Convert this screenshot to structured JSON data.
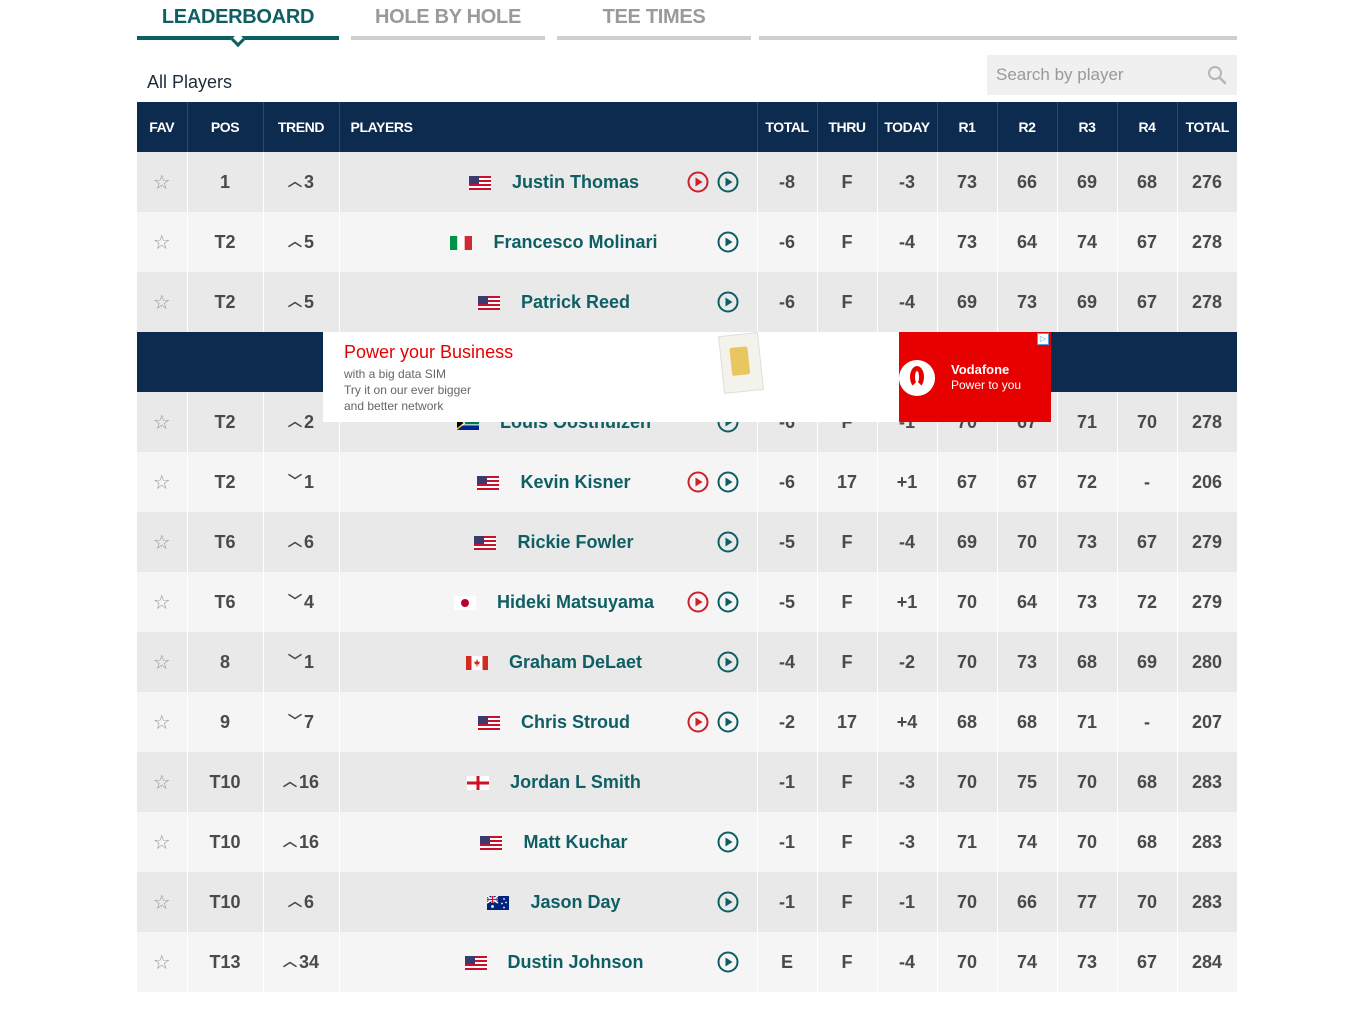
{
  "tabs": [
    {
      "label": "LEADERBOARD",
      "active": true
    },
    {
      "label": "HOLE BY HOLE",
      "active": false
    },
    {
      "label": "TEE TIMES",
      "active": false
    }
  ],
  "filter_label": "All Players",
  "search": {
    "placeholder": "Search by player",
    "icon": "search-icon"
  },
  "columns": [
    "FAV",
    "POS",
    "TREND",
    "PLAYERS",
    "TOTAL",
    "THRU",
    "TODAY",
    "R1",
    "R2",
    "R3",
    "R4",
    "TOTAL"
  ],
  "colors": {
    "header_bg": "#0c2b4e",
    "accent": "#0e5f63",
    "trend_up": "#3aa36f",
    "trend_down": "#d0202a",
    "video_red": "#d0202a"
  },
  "ad": {
    "title": "Power your Business",
    "lines": [
      "with a big data SIM",
      "Try it on our ever bigger",
      "and better network"
    ],
    "brand": "Vodafone",
    "tagline": "Power to you",
    "insert_after_row": 3
  },
  "rows": [
    {
      "pos": "1",
      "trend_dir": "up",
      "trend": "3",
      "flag": "us",
      "name": "Justin Thomas",
      "live": true,
      "play": true,
      "total": "-8",
      "thru": "F",
      "today": "-3",
      "r1": "73",
      "r2": "66",
      "r3": "69",
      "r4": "68",
      "strokes": "276"
    },
    {
      "pos": "T2",
      "trend_dir": "up",
      "trend": "5",
      "flag": "it",
      "name": "Francesco Molinari",
      "live": false,
      "play": true,
      "total": "-6",
      "thru": "F",
      "today": "-4",
      "r1": "73",
      "r2": "64",
      "r3": "74",
      "r4": "67",
      "strokes": "278"
    },
    {
      "pos": "T2",
      "trend_dir": "up",
      "trend": "5",
      "flag": "us",
      "name": "Patrick Reed",
      "live": false,
      "play": true,
      "total": "-6",
      "thru": "F",
      "today": "-4",
      "r1": "69",
      "r2": "73",
      "r3": "69",
      "r4": "67",
      "strokes": "278"
    },
    {
      "pos": "T2",
      "trend_dir": "up",
      "trend": "2",
      "flag": "za",
      "name": "Louis Oosthuizen",
      "live": false,
      "play": true,
      "total": "-6",
      "thru": "F",
      "today": "-1",
      "r1": "70",
      "r2": "67",
      "r3": "71",
      "r4": "70",
      "strokes": "278"
    },
    {
      "pos": "T2",
      "trend_dir": "down",
      "trend": "1",
      "flag": "us",
      "name": "Kevin Kisner",
      "live": true,
      "play": true,
      "total": "-6",
      "thru": "17",
      "today": "+1",
      "r1": "67",
      "r2": "67",
      "r3": "72",
      "r4": "-",
      "strokes": "206"
    },
    {
      "pos": "T6",
      "trend_dir": "up",
      "trend": "6",
      "flag": "us",
      "name": "Rickie Fowler",
      "live": false,
      "play": true,
      "total": "-5",
      "thru": "F",
      "today": "-4",
      "r1": "69",
      "r2": "70",
      "r3": "73",
      "r4": "67",
      "strokes": "279"
    },
    {
      "pos": "T6",
      "trend_dir": "down",
      "trend": "4",
      "flag": "jp",
      "name": "Hideki Matsuyama",
      "live": true,
      "play": true,
      "total": "-5",
      "thru": "F",
      "today": "+1",
      "r1": "70",
      "r2": "64",
      "r3": "73",
      "r4": "72",
      "strokes": "279"
    },
    {
      "pos": "8",
      "trend_dir": "down",
      "trend": "1",
      "flag": "ca",
      "name": "Graham DeLaet",
      "live": false,
      "play": true,
      "total": "-4",
      "thru": "F",
      "today": "-2",
      "r1": "70",
      "r2": "73",
      "r3": "68",
      "r4": "69",
      "strokes": "280"
    },
    {
      "pos": "9",
      "trend_dir": "down",
      "trend": "7",
      "flag": "us",
      "name": "Chris Stroud",
      "live": true,
      "play": true,
      "total": "-2",
      "thru": "17",
      "today": "+4",
      "r1": "68",
      "r2": "68",
      "r3": "71",
      "r4": "-",
      "strokes": "207"
    },
    {
      "pos": "T10",
      "trend_dir": "up",
      "trend": "16",
      "flag": "en",
      "name": "Jordan L Smith",
      "live": false,
      "play": false,
      "total": "-1",
      "thru": "F",
      "today": "-3",
      "r1": "70",
      "r2": "75",
      "r3": "70",
      "r4": "68",
      "strokes": "283"
    },
    {
      "pos": "T10",
      "trend_dir": "up",
      "trend": "16",
      "flag": "us",
      "name": "Matt Kuchar",
      "live": false,
      "play": true,
      "total": "-1",
      "thru": "F",
      "today": "-3",
      "r1": "71",
      "r2": "74",
      "r3": "70",
      "r4": "68",
      "strokes": "283"
    },
    {
      "pos": "T10",
      "trend_dir": "up",
      "trend": "6",
      "flag": "au",
      "name": "Jason Day",
      "live": false,
      "play": true,
      "total": "-1",
      "thru": "F",
      "today": "-1",
      "r1": "70",
      "r2": "66",
      "r3": "77",
      "r4": "70",
      "strokes": "283"
    },
    {
      "pos": "T13",
      "trend_dir": "up",
      "trend": "34",
      "flag": "us",
      "name": "Dustin Johnson",
      "live": false,
      "play": true,
      "total": "E",
      "thru": "F",
      "today": "-4",
      "r1": "70",
      "r2": "74",
      "r3": "73",
      "r4": "67",
      "strokes": "284"
    }
  ]
}
